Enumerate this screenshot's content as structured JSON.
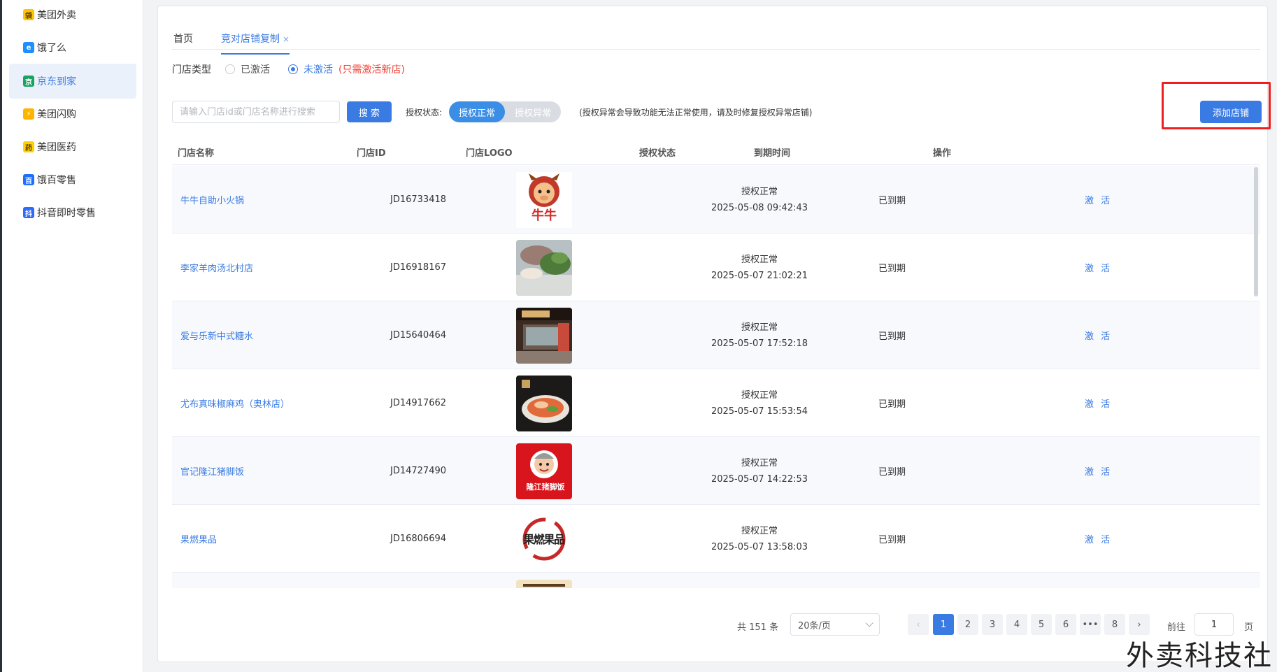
{
  "sidebar": {
    "items": [
      {
        "label": "美团外卖",
        "icon": "meituan-waimai-icon",
        "color": "#ffc300",
        "glyph": "袋"
      },
      {
        "label": "饿了么",
        "icon": "eleme-icon",
        "color": "#1e8fff",
        "glyph": "e"
      },
      {
        "label": "京东到家",
        "icon": "jd-daojia-icon",
        "color": "#1aa260",
        "glyph": "京"
      },
      {
        "label": "美团闪购",
        "icon": "meituan-shangou-icon",
        "color": "#ffb400",
        "glyph": "⚡"
      },
      {
        "label": "美团医药",
        "icon": "meituan-yiyao-icon",
        "color": "#ffd100",
        "glyph": "药"
      },
      {
        "label": "饿百零售",
        "icon": "ebai-lingshou-icon",
        "color": "#1e6fff",
        "glyph": "百"
      },
      {
        "label": "抖音即时零售",
        "icon": "douyin-retail-icon",
        "color": "#2d6bff",
        "glyph": "抖"
      }
    ],
    "active_index": 2
  },
  "tabs": {
    "home": "首页",
    "current": "竞对店铺复制",
    "close_glyph": "×"
  },
  "filters": {
    "type_label": "门店类型",
    "activated": "已激活",
    "not_activated": "未激活",
    "not_activated_hint": "(只需激活新店)",
    "search_placeholder": "请输入门店id或门店名称进行搜索",
    "search_button": "搜 索",
    "auth_label": "授权状态:",
    "auth_normal": "授权正常",
    "auth_abnormal": "授权异常",
    "auth_note": "(授权异常会导致功能无法正常使用，请及时修复授权异常店铺)",
    "add_button": "添加店铺"
  },
  "table": {
    "headers": {
      "name": "门店名称",
      "id": "门店ID",
      "logo": "门店LOGO",
      "auth": "授权状态",
      "expire": "到期时间",
      "op": "操作"
    },
    "rows": [
      {
        "name": "牛牛自助小火锅",
        "id": "JD16733418",
        "logo": "niuniu-logo",
        "logo_text": "牛牛",
        "auth": "授权正常",
        "time": "2025-05-08 09:42:43",
        "expire": "已到期",
        "op": "激 活"
      },
      {
        "name": "李家羊肉汤北村店",
        "id": "JD16918167",
        "logo": "lamb-soup-photo",
        "auth": "授权正常",
        "time": "2025-05-07 21:02:21",
        "expire": "已到期",
        "op": "激 活"
      },
      {
        "name": "爱与乐新中式糖水",
        "id": "JD15640464",
        "logo": "storefront-photo",
        "auth": "授权正常",
        "time": "2025-05-07 17:52:18",
        "expire": "已到期",
        "op": "激 活"
      },
      {
        "name": "尤布真味椒麻鸡（奥林店）",
        "id": "JD14917662",
        "logo": "chicken-dish-photo",
        "auth": "授权正常",
        "time": "2025-05-07 15:53:54",
        "expire": "已到期",
        "op": "激 活"
      },
      {
        "name": "官记隆江猪脚饭",
        "id": "JD14727490",
        "logo": "pork-rice-logo",
        "logo_text": "隆江猪脚饭",
        "auth": "授权正常",
        "time": "2025-05-07 14:22:53",
        "expire": "已到期",
        "op": "激 活"
      },
      {
        "name": "果燃果品",
        "id": "JD16806694",
        "logo": "guoran-logo",
        "logo_text": "果燃果品",
        "auth": "授权正常",
        "time": "2025-05-07 13:58:03",
        "expire": "已到期",
        "op": "激 活"
      }
    ]
  },
  "pagination": {
    "total": "共 151 条",
    "page_size": "20条/页",
    "pages": [
      "1",
      "2",
      "3",
      "4",
      "5",
      "6",
      "•••",
      "8"
    ],
    "current": "1",
    "prev": "‹",
    "next": "›",
    "goto_label": "前往",
    "goto_value": "1",
    "page_unit": "页"
  },
  "watermark": "外卖科技社",
  "colors": {
    "accent": "#3a7be3",
    "danger": "#f04438",
    "highlight_box": "#ef1f1f"
  }
}
